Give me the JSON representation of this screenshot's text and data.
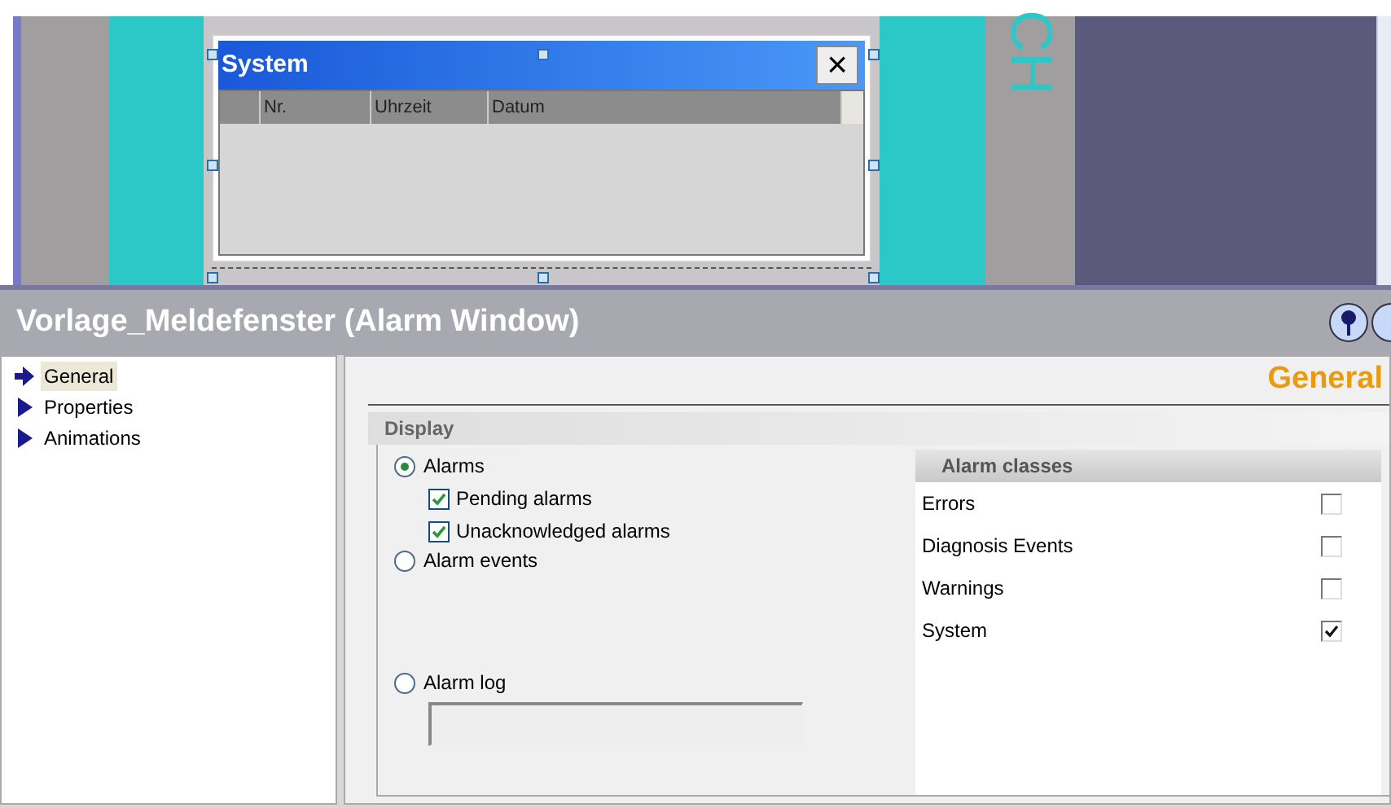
{
  "canvas": {
    "vertical_text": "CH",
    "alarm_window": {
      "title": "System",
      "close": "×",
      "columns": [
        "Nr.",
        "Uhrzeit",
        "Datum"
      ]
    }
  },
  "panel": {
    "title": "Vorlage_Meldefenster (Alarm Window)"
  },
  "nav": [
    {
      "label": "General",
      "selected": true
    },
    {
      "label": "Properties",
      "selected": false
    },
    {
      "label": "Animations",
      "selected": false
    }
  ],
  "section_title": "General",
  "display": {
    "title": "Display",
    "options": [
      {
        "label": "Alarms",
        "selected": true,
        "kind": "plain",
        "children": [
          {
            "label": "Pending alarms",
            "checked": true
          },
          {
            "label": "Unacknowledged alarms",
            "checked": true
          }
        ]
      },
      {
        "label": "Alarm events",
        "selected": false,
        "kind": "plain"
      },
      {
        "label": "Alarm log",
        "selected": false,
        "kind": "with_field"
      }
    ],
    "classes": {
      "title": "Alarm classes",
      "items": [
        {
          "label": "Errors",
          "checked": false
        },
        {
          "label": "Diagnosis Events",
          "checked": false
        },
        {
          "label": "Warnings",
          "checked": false
        },
        {
          "label": "System",
          "checked": true
        }
      ]
    }
  }
}
